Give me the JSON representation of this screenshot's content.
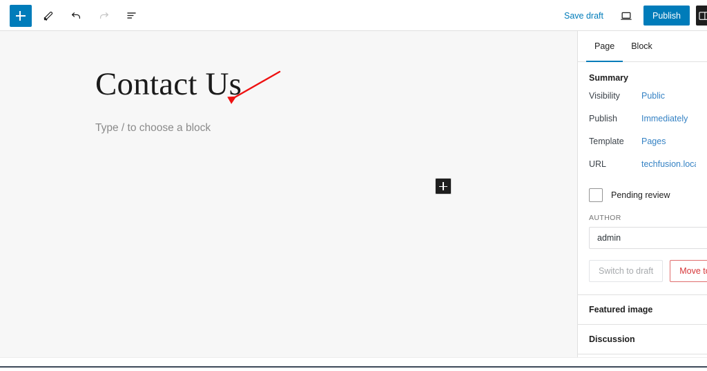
{
  "toolbar": {
    "add_block_label": "+",
    "add_block_icon": "plus-icon",
    "tools_icon": "pencil-icon",
    "undo_icon": "undo-icon",
    "redo_icon": "redo-icon",
    "list_view_icon": "document-outline-icon",
    "save_draft_label": "Save draft",
    "preview_icon": "desktop-preview-icon",
    "publish_label": "Publish",
    "settings_toggle_icon": "settings-sidebar-icon"
  },
  "editor": {
    "title": "Contact Us",
    "block_placeholder": "Type / to choose a block",
    "inserter_icon": "plus-icon",
    "annotation_icon": "red-arrow-annotation"
  },
  "sidebar": {
    "tabs": [
      {
        "label": "Page",
        "active": true
      },
      {
        "label": "Block",
        "active": false
      }
    ],
    "summary_heading": "Summary",
    "summary_rows": [
      {
        "label": "Visibility",
        "value": "Public"
      },
      {
        "label": "Publish",
        "value": "Immediately"
      },
      {
        "label": "Template",
        "value": "Pages"
      },
      {
        "label": "URL",
        "value": "techfusion.local/aut"
      }
    ],
    "pending_review_label": "Pending review",
    "pending_review_checked": false,
    "author_label": "AUTHOR",
    "author_value": "admin",
    "switch_to_draft_label": "Switch to draft",
    "move_to_trash_label": "Move to trash",
    "panels": [
      {
        "label": "Featured image"
      },
      {
        "label": "Discussion"
      }
    ]
  },
  "colors": {
    "accent_blue": "#007cba",
    "link_blue": "#3582c4",
    "danger_red": "#d63638",
    "annotation_red": "#ee1111",
    "canvas_bg": "#f7f7f7",
    "dark": "#1e1e1e"
  }
}
